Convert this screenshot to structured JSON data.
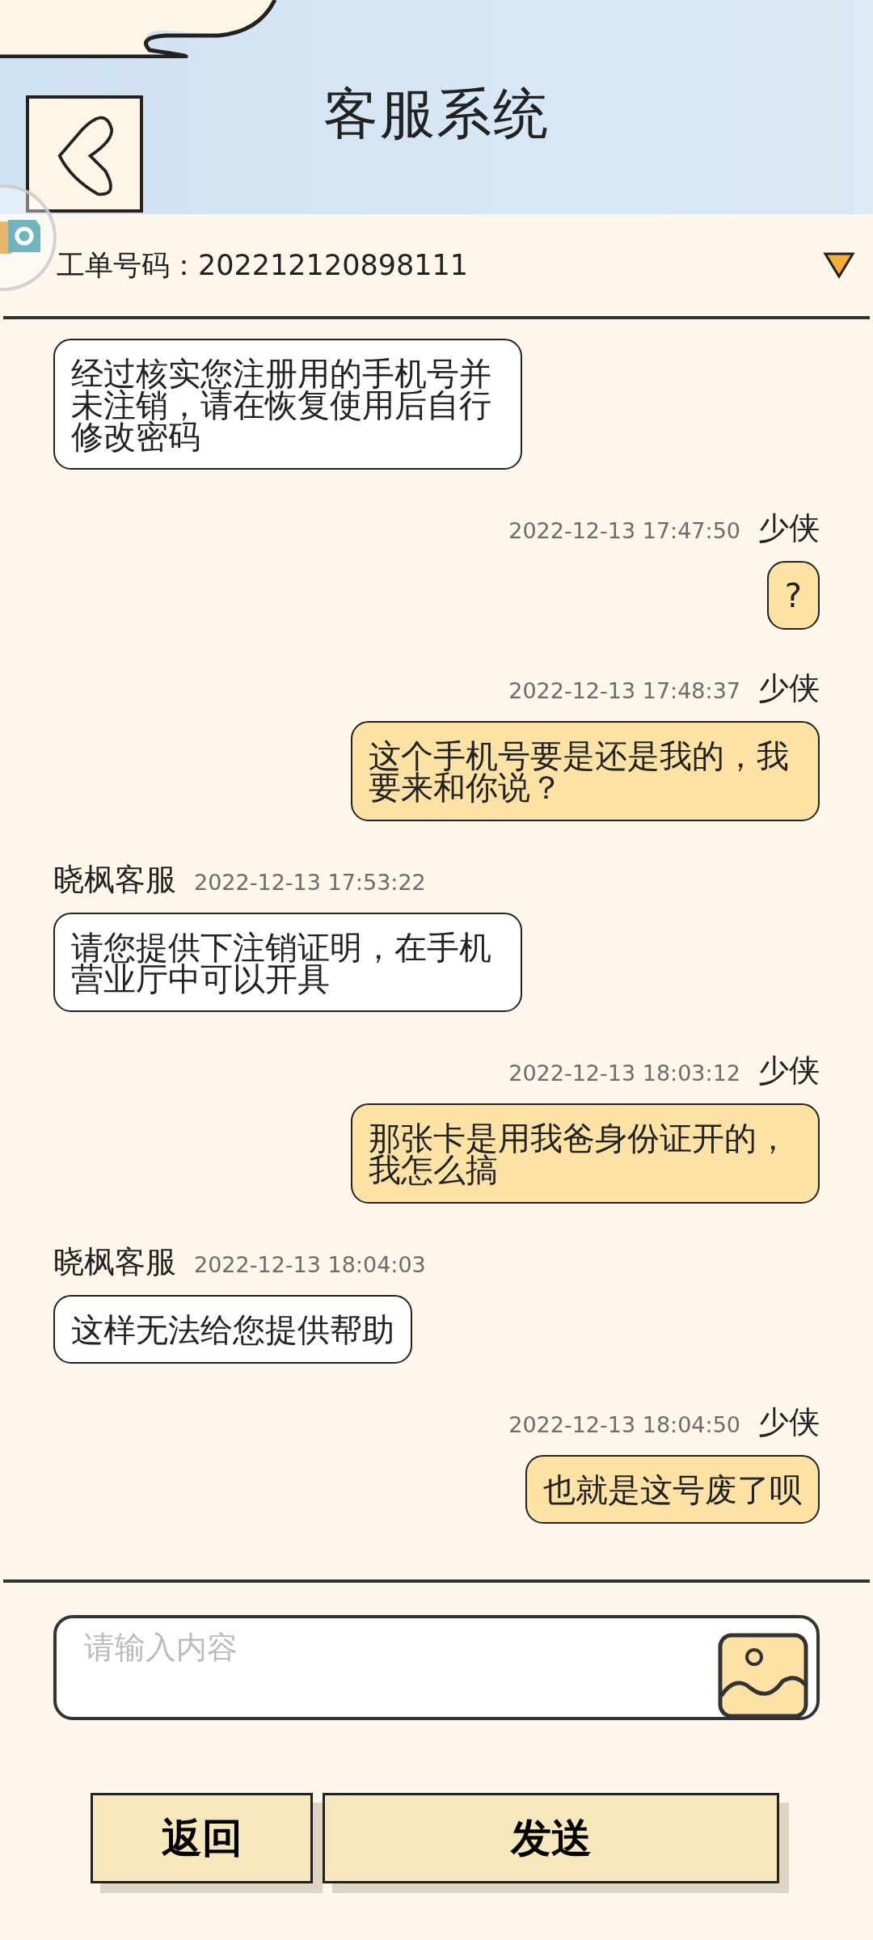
{
  "header": {
    "title": "客服系统"
  },
  "ticket": {
    "label": "工单号码：202212120898111"
  },
  "messages": [
    {
      "kind": "agent",
      "text": "经过核实您注册用的手机号并未注销，请在恢复使用后自行修改密码"
    },
    {
      "kind": "user",
      "name": "少侠",
      "time": "2022-12-13 17:47:50",
      "text": "?"
    },
    {
      "kind": "user",
      "name": "少侠",
      "time": "2022-12-13 17:48:37",
      "text": "这个手机号要是还是我的，我要来和你说？"
    },
    {
      "kind": "agent",
      "name": "晓枫客服",
      "time": "2022-12-13 17:53:22",
      "text": "请您提供下注销证明，在手机营业厅中可以开具"
    },
    {
      "kind": "user",
      "name": "少侠",
      "time": "2022-12-13 18:03:12",
      "text": "那张卡是用我爸身份证开的，我怎么搞"
    },
    {
      "kind": "agent",
      "name": "晓枫客服",
      "time": "2022-12-13 18:04:03",
      "text": "这样无法给您提供帮助"
    },
    {
      "kind": "user",
      "name": "少侠",
      "time": "2022-12-13 18:04:50",
      "text": "也就是这号废了呗"
    }
  ],
  "composer": {
    "placeholder": "请输入内容"
  },
  "buttons": [
    {
      "kind": "back",
      "label": "返回"
    },
    {
      "kind": "send",
      "label": "发送"
    }
  ]
}
